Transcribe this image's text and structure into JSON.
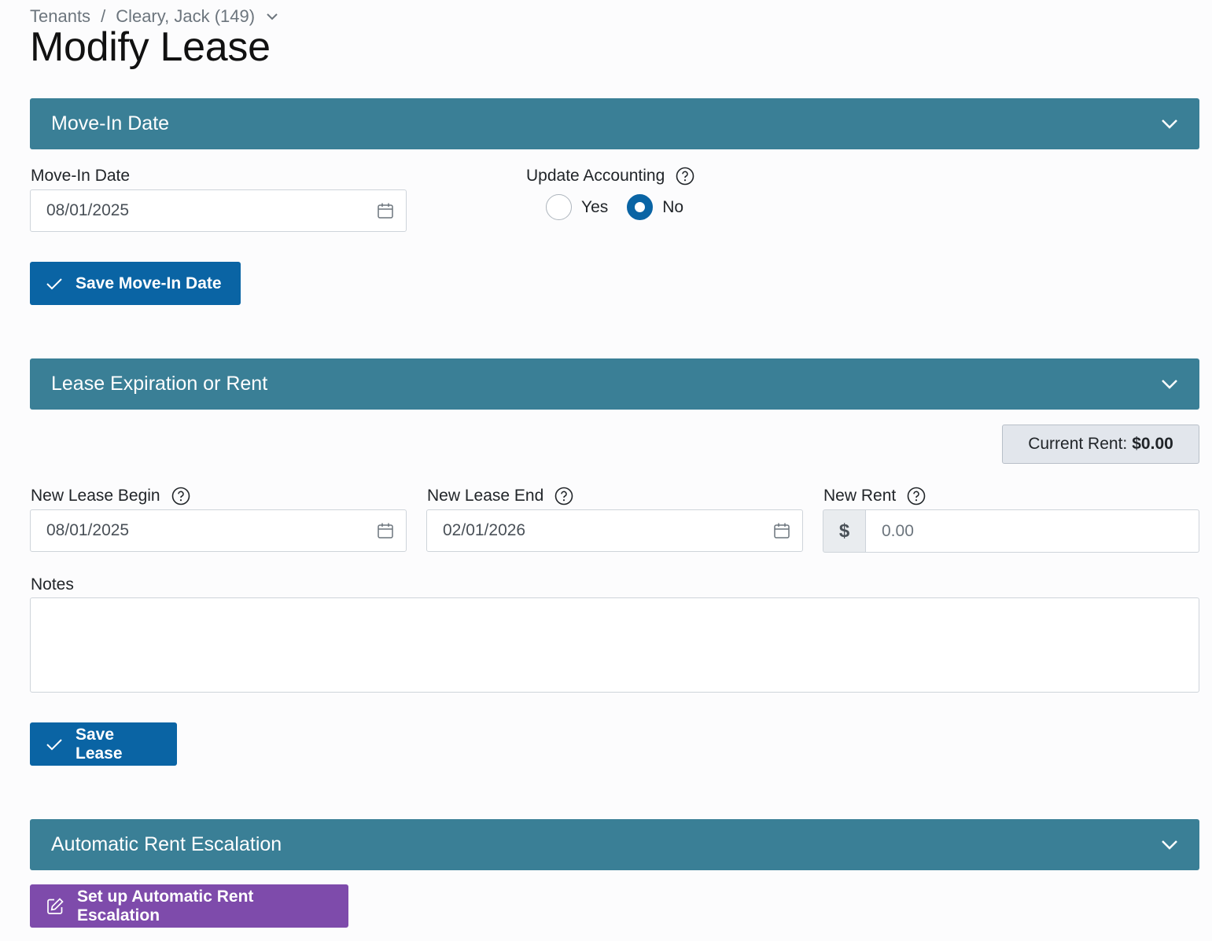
{
  "breadcrumb": {
    "root": "Tenants",
    "separator": "/",
    "current": "Cleary, Jack",
    "current_id": "(149)"
  },
  "page_title": "Modify Lease",
  "sections": {
    "move_in": {
      "header": "Move-In Date",
      "date_label": "Move-In Date",
      "date_value": "08/01/2025",
      "update_accounting_label": "Update Accounting",
      "radio_yes": "Yes",
      "radio_no": "No",
      "selected": "No",
      "save_button": "Save Move-In Date"
    },
    "lease": {
      "header": "Lease Expiration or Rent",
      "current_rent_label": "Current Rent:",
      "current_rent_value": "$0.00",
      "begin_label": "New Lease Begin",
      "begin_value": "08/01/2025",
      "end_label": "New Lease End",
      "end_value": "02/01/2026",
      "rent_label": "New Rent",
      "currency_symbol": "$",
      "rent_placeholder": "0.00",
      "notes_label": "Notes",
      "notes_value": "",
      "save_button": "Save Lease"
    },
    "escalation": {
      "header": "Automatic Rent Escalation",
      "setup_button": "Set up Automatic Rent Escalation"
    }
  },
  "colors": {
    "section_header": "#3a7f96",
    "primary_button": "#0a64a4",
    "purple_button": "#7e4bab",
    "badge_bg": "#e2e6ec"
  },
  "icons": [
    "chevron-down-icon",
    "calendar-icon",
    "help-icon",
    "check-icon",
    "edit-icon"
  ]
}
